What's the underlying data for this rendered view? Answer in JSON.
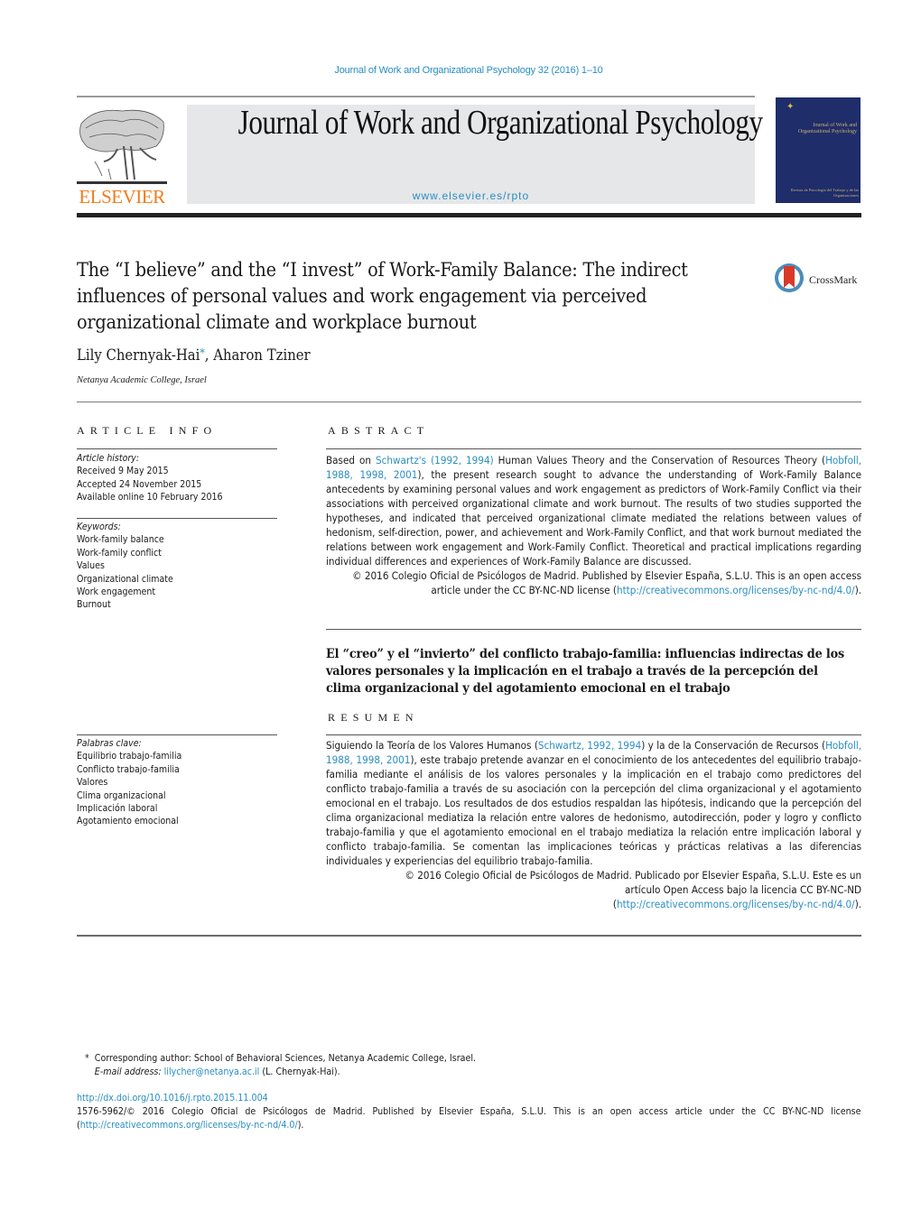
{
  "running_head": "Journal of Work and Organizational Psychology 32 (2016) 1–10",
  "masthead": {
    "publisher_logo_label": "ELSEVIER",
    "journal_title": "Journal of Work and Organizational Psychology",
    "journal_url": "www.elsevier.es/rpto",
    "cover_title": "Journal of Work and Organizational Psychology",
    "cover_subtitle": "Revista de Psicología del Trabajo y de las Organizaciones"
  },
  "article": {
    "title": "The “I believe” and the “I invest” of Work-Family Balance: The indirect influences of personal values and work engagement via perceived organizational climate and workplace burnout",
    "crossmark_label": "CrossMark",
    "authors": [
      {
        "name": "Lily Chernyak-Hai",
        "mark": "*"
      },
      {
        "name": "Aharon Tziner",
        "mark": ""
      }
    ],
    "author_separator": ", ",
    "affiliation": "Netanya Academic College, Israel"
  },
  "article_info": {
    "heading": "ARTICLE INFO",
    "history_label": "Article history:",
    "history": [
      "Received 9 May 2015",
      "Accepted 24 November 2015",
      "Available online 10 February 2016"
    ],
    "keywords_label": "Keywords:",
    "keywords": [
      "Work-family balance",
      "Work-family conflict",
      "Values",
      "Organizational climate",
      "Work engagement",
      "Burnout"
    ],
    "palabras_label": "Palabras clave:",
    "palabras": [
      "Equilibrio trabajo-familia",
      "Conflicto trabajo-familia",
      "Valores",
      "Clima organizacional",
      "Implicación laboral",
      "Agotamiento emocional"
    ]
  },
  "abstract": {
    "heading": "ABSTRACT",
    "pre_link1": "Based on ",
    "link1": "Schwartz's (1992, 1994)",
    "mid1": " Human Values Theory and the Conservation of Resources Theory (",
    "link2": "Hobfoll, 1988, 1998, 2001",
    "rest": "), the present research sought to advance the understanding of Work-Family Balance antecedents by examining personal values and work engagement as predictors of Work-Family Conflict via their associations with perceived organizational climate and work burnout. The results of two studies supported the hypotheses, and indicated that perceived organizational climate mediated the relations between values of hedonism, self-direction, power, and achievement and Work-Family Conflict, and that work burnout mediated the relations between work engagement and Work-Family Conflict. Theoretical and practical implications regarding individual differences and experiences of Work-Family Balance are discussed.",
    "copyright_pre": "© 2016 Colegio Oficial de Psicólogos de Madrid. Published by Elsevier España, S.L.U. This is an open access article under the CC BY-NC-ND license (",
    "license_link": "http://creativecommons.org/licenses/by-nc-nd/4.0/",
    "copyright_post": ")."
  },
  "spanish": {
    "title": "El “creo” y el “invierto” del conflicto trabajo-familia: influencias indirectas de los valores personales y la implicación en el trabajo a través de la percepción del clima organizacional y del agotamiento emocional en el trabajo",
    "heading": "RESUMEN",
    "pre_link1": "Siguiendo la Teoría de los Valores Humanos (",
    "link1": "Schwartz, 1992, 1994",
    "mid1": ") y la de la Conservación de Recursos (",
    "link2": "Hobfoll, 1988, 1998, 2001",
    "rest": "), este trabajo pretende avanzar en el conocimiento de los antecedentes del equilibrio trabajo-familia mediante el análisis de los valores personales y la implicación en el trabajo como predictores del conflicto trabajo-familia a través de su asociación con la percepción del clima organizacional y el agotamiento emocional en el trabajo. Los resultados de dos estudios respaldan las hipótesis, indicando que la percepción del clima organizacional mediatiza la relación entre valores de hedonismo, autodirección, poder y logro y conflicto trabajo-familia y que el agotamiento emocional en el trabajo mediatiza la relación entre implicación laboral y conflicto trabajo-familia. Se comentan las implicaciones teóricas y prácticas relativas a las diferencias individuales y experiencias del equilibrio trabajo-familia.",
    "copyright_line1": "© 2016 Colegio Oficial de Psicólogos de Madrid. Publicado por Elsevier España, S.L.U. Este es un",
    "copyright_line2": "artículo Open Access bajo la licencia CC BY-NC-ND",
    "copyright_pre3": "(",
    "license_link": "http://creativecommons.org/licenses/by-nc-nd/4.0/",
    "copyright_post": ")."
  },
  "footnotes": {
    "corresponding_mark": "*",
    "corresponding": "Corresponding author: School of Behavioral Sciences, Netanya Academic College, Israel.",
    "email_label": "E-mail address:",
    "email": "lilycher@netanya.ac.il",
    "email_owner": " (L. Chernyak-Hai).",
    "doi": "http://dx.doi.org/10.1016/j.rpto.2015.11.004",
    "issn_copyright": "1576-5962/© 2016 Colegio Oficial de Psicólogos de Madrid. Published by Elsevier España, S.L.U. This is an open access article under the CC BY-NC-ND license",
    "license_pre": "(",
    "license_link": "http://creativecommons.org/licenses/by-nc-nd/4.0/",
    "license_post": ")."
  },
  "colors": {
    "link": "#2a8ec2",
    "elsevier_orange": "#f07c1a",
    "cover_blue": "#1f2d6b",
    "banner_gray": "#e6e7e8"
  }
}
